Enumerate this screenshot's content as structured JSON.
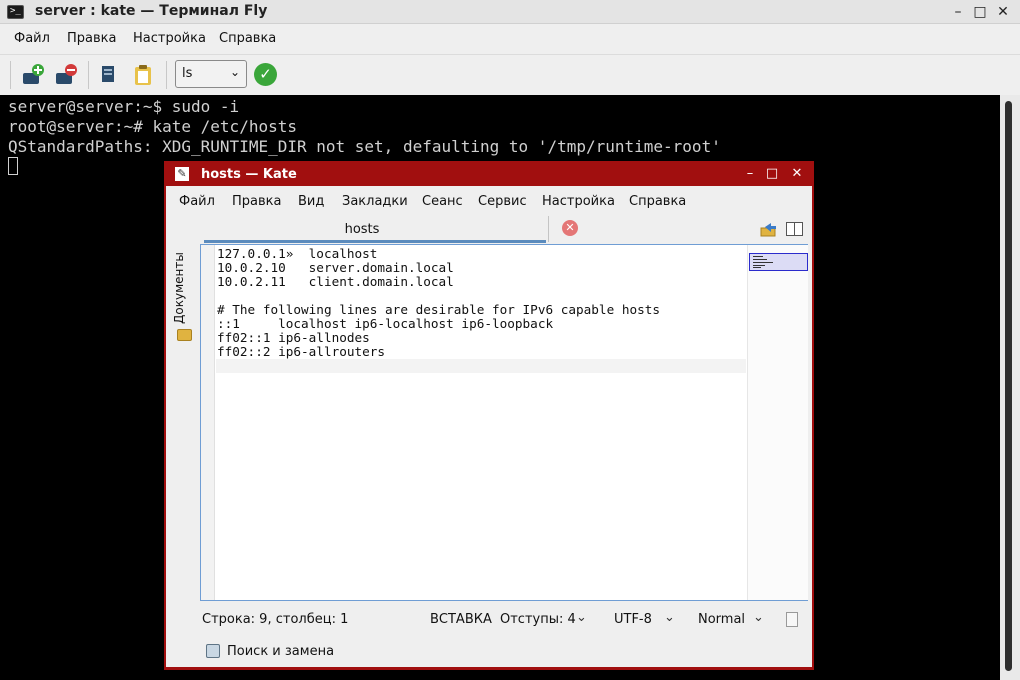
{
  "terminal": {
    "title": "server : kate — Терминал Fly",
    "menu": [
      "Файл",
      "Правка",
      "Настройка",
      "Справка"
    ],
    "command_select": "ls",
    "lines": [
      "server@server:~$ sudo -i",
      "root@server:~# kate /etc/hosts",
      "QStandardPaths: XDG_RUNTIME_DIR not set, defaulting to '/tmp/runtime-root'"
    ]
  },
  "kate": {
    "title": "hosts — Kate",
    "menu": [
      "Файл",
      "Правка",
      "Вид",
      "Закладки",
      "Сеанс",
      "Сервис",
      "Настройка",
      "Справка"
    ],
    "side_panel_label": "Документы",
    "tab_label": "hosts",
    "code_lines": [
      "127.0.0.1»  localhost",
      "10.0.2.10   server.domain.local",
      "10.0.2.11   client.domain.local",
      "",
      "# The following lines are desirable for IPv6 capable hosts",
      "::1     localhost ip6-localhost ip6-loopback",
      "ff02::1 ip6-allnodes",
      "ff02::2 ip6-allrouters"
    ],
    "status": {
      "position": "Строка: 9, столбец: 1",
      "mode": "ВСТАВКА",
      "indent": "Отступы: 4",
      "encoding": "UTF-8",
      "highlight": "Normal"
    },
    "search_replace": "Поиск и замена"
  },
  "colors": {
    "kate_frame": "#a10f0f",
    "terminal_bg": "#000000",
    "terminal_fg": "#d0d0d0",
    "tab_underline": "#5b8bbd"
  }
}
